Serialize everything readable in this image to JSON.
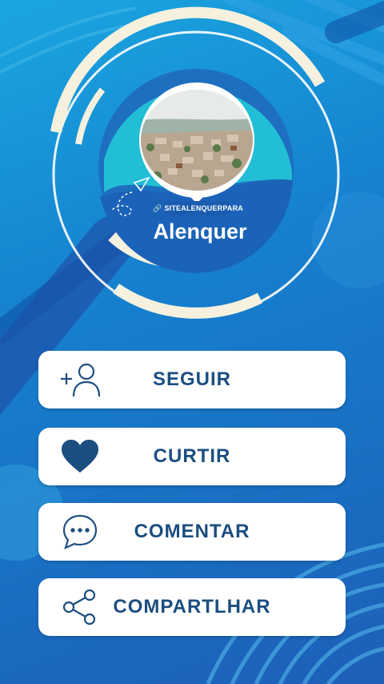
{
  "profile": {
    "handle": "SITEALENQUERPARA",
    "city_name": "Alenquer"
  },
  "actions": [
    {
      "label": "SEGUIR",
      "icon": "add-user-icon"
    },
    {
      "label": "CURTIR",
      "icon": "heart-icon"
    },
    {
      "label": "COMENTAR",
      "icon": "speech-bubble-icon"
    },
    {
      "label": "COMPARTLHAR",
      "icon": "share-icon"
    }
  ],
  "colors": {
    "accent": "#1c4e80",
    "background": "#1680cf",
    "button_bg": "#ffffff",
    "teal": "#22c7d8"
  }
}
